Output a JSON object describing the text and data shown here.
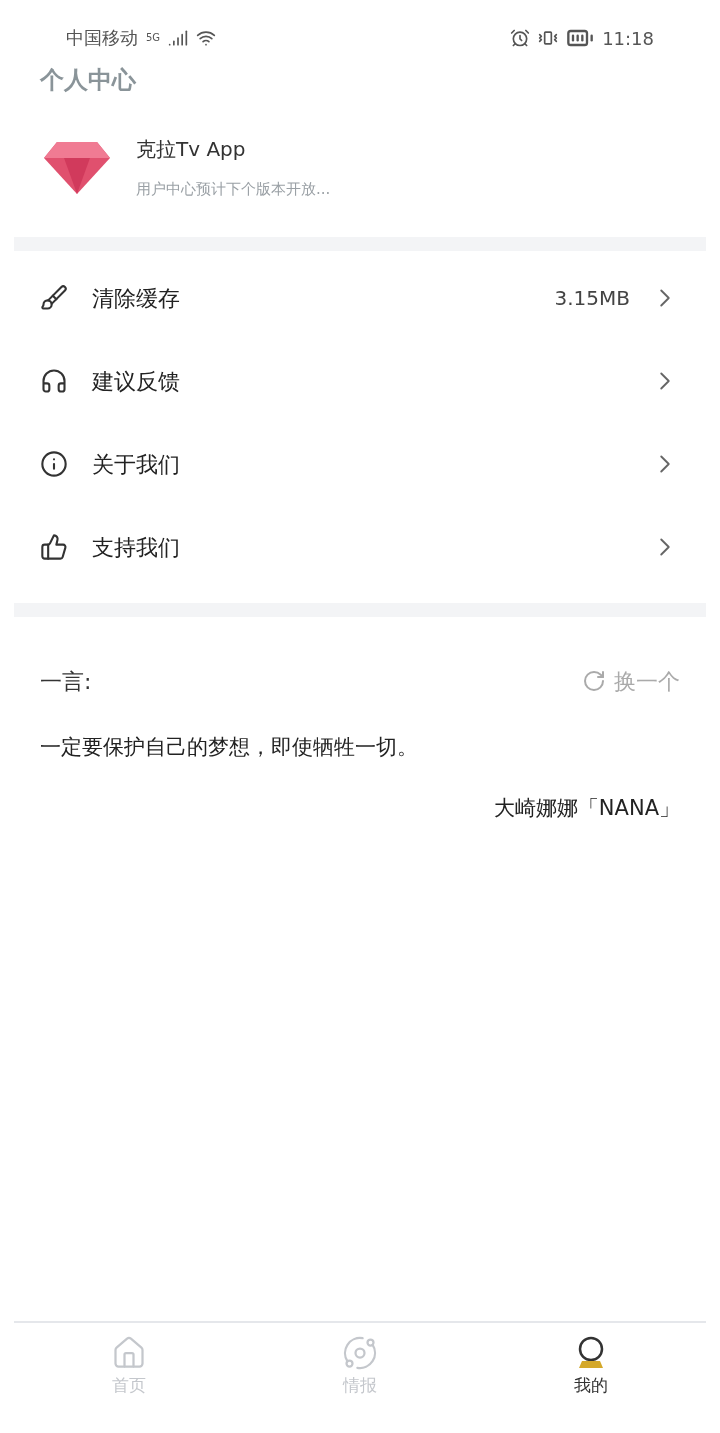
{
  "status_bar": {
    "carrier": "中国移动",
    "network": "5G",
    "time": "11:18"
  },
  "header": {
    "title": "个人中心"
  },
  "profile": {
    "name": "克拉Tv App",
    "subtitle": "用户中心预计下个版本开放..."
  },
  "menu": [
    {
      "kind": "clean",
      "label": "清除缓存",
      "value": "3.15MB"
    },
    {
      "kind": "feedback",
      "label": "建议反馈"
    },
    {
      "kind": "about",
      "label": "关于我们"
    },
    {
      "kind": "support",
      "label": "支持我们"
    }
  ],
  "quote": {
    "title": "一言:",
    "refresh": "换一个",
    "text": "一定要保护自己的梦想，即使牺牲一切。",
    "author": "大崎娜娜「NANA」"
  },
  "tabs": [
    {
      "kind": "home",
      "label": "首页",
      "selected": false
    },
    {
      "kind": "news",
      "label": "情报",
      "selected": false
    },
    {
      "kind": "mine",
      "label": "我的",
      "selected": true
    }
  ]
}
